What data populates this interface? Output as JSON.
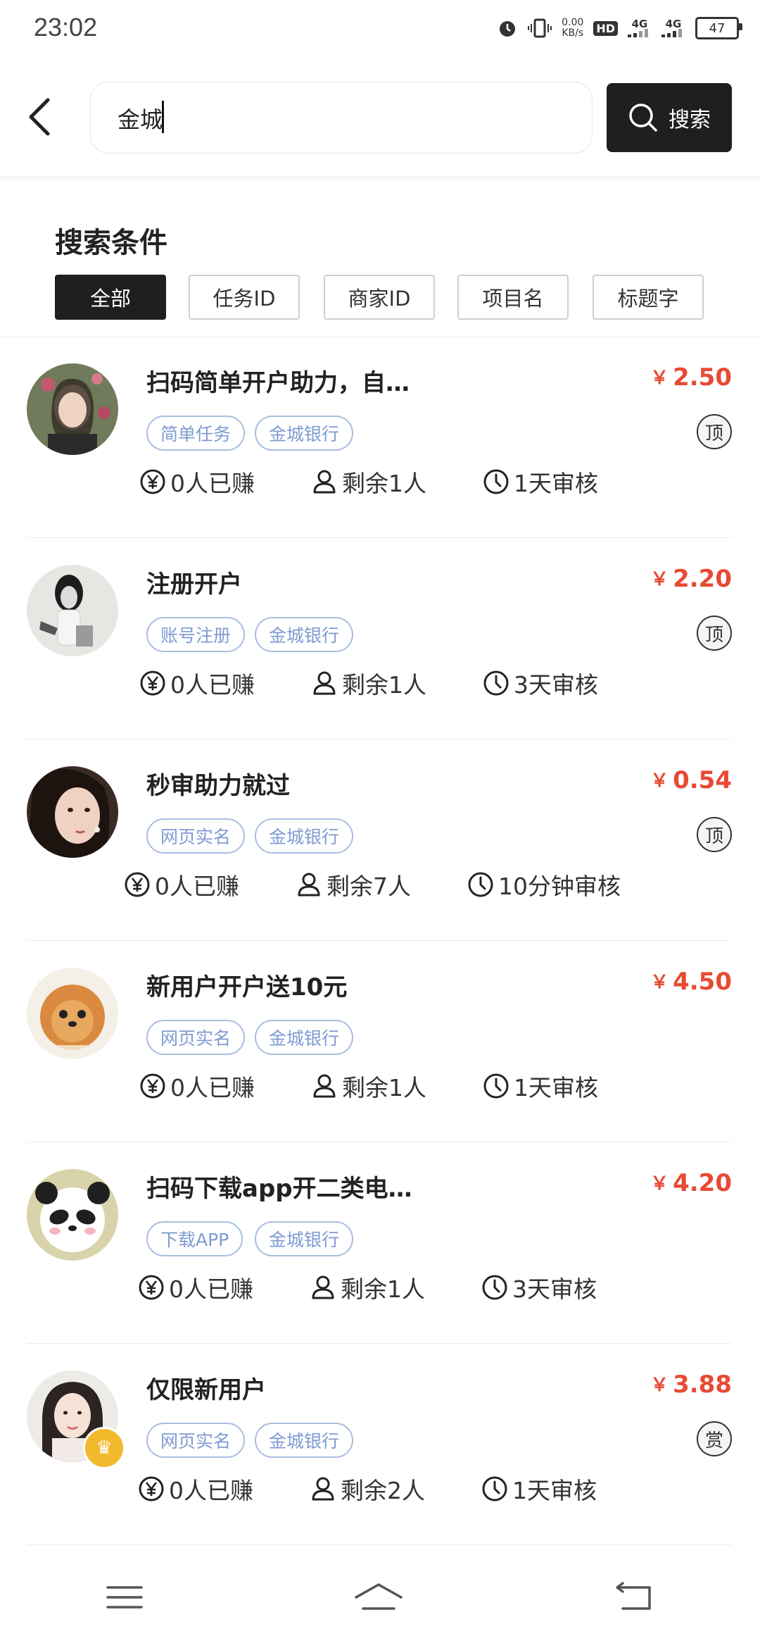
{
  "status_bar": {
    "time": "23:02",
    "net_speed": "0.00",
    "net_unit": "KB/s",
    "hd_label": "HD",
    "sim1": "4G",
    "sim2": "4G",
    "battery": "47"
  },
  "search": {
    "value": "金城",
    "button_label": "搜索"
  },
  "filters": {
    "title": "搜索条件",
    "chips": [
      "全部",
      "任务ID",
      "商家ID",
      "项目名",
      "标题字"
    ],
    "active_index": 0
  },
  "tasks": [
    {
      "title": "扫码简单开户助力，自…",
      "price": "2.50",
      "tags": [
        "简单任务",
        "金城银行"
      ],
      "badge": "顶",
      "earned": "0人已赚",
      "remaining": "剩余1人",
      "review": "1天审核"
    },
    {
      "title": "注册开户",
      "price": "2.20",
      "tags": [
        "账号注册",
        "金城银行"
      ],
      "badge": "顶",
      "earned": "0人已赚",
      "remaining": "剩余1人",
      "review": "3天审核"
    },
    {
      "title": "秒审助力就过",
      "price": "0.54",
      "tags": [
        "网页实名",
        "金城银行"
      ],
      "badge": "顶",
      "earned": "0人已赚",
      "remaining": "剩余7人",
      "review": "10分钟审核"
    },
    {
      "title": "新用户开户送10元",
      "price": "4.50",
      "tags": [
        "网页实名",
        "金城银行"
      ],
      "badge": "",
      "earned": "0人已赚",
      "remaining": "剩余1人",
      "review": "1天审核"
    },
    {
      "title": "扫码下载app开二类电…",
      "price": "4.20",
      "tags": [
        "下载APP",
        "金城银行"
      ],
      "badge": "",
      "earned": "0人已赚",
      "remaining": "剩余1人",
      "review": "3天审核"
    },
    {
      "title": "仅限新用户",
      "price": "3.88",
      "tags": [
        "网页实名",
        "金城银行"
      ],
      "badge": "赏",
      "earned": "0人已赚",
      "remaining": "剩余2人",
      "review": "1天审核"
    }
  ],
  "currency_symbol": "￥",
  "colors": {
    "accent_dark": "#1f1f1f",
    "price_red": "#e84a33",
    "tag_blue": "#7f9bd1"
  }
}
